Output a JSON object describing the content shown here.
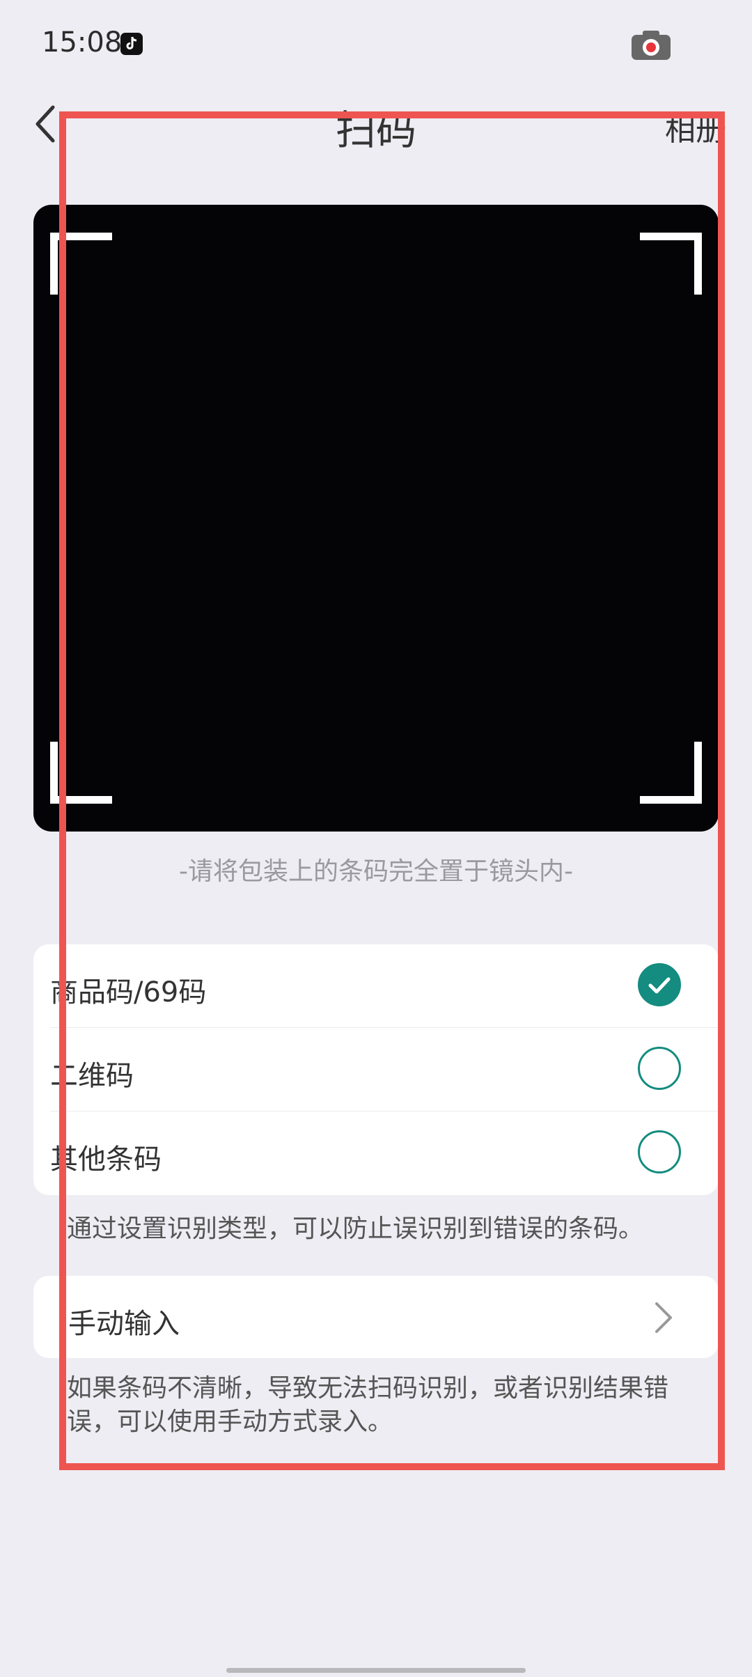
{
  "status_bar": {
    "time": "15:08",
    "app_icon": "tiktok-icon",
    "record_icon": "screen-record-icon"
  },
  "nav": {
    "back_icon": "chevron-left-icon",
    "title": "扫码",
    "album": "相册"
  },
  "scanner": {
    "hint": "-请将包装上的条码完全置于镜头内-"
  },
  "code_types": {
    "options": [
      {
        "label": "商品码/69码",
        "selected": true
      },
      {
        "label": "二维码",
        "selected": false
      },
      {
        "label": "其他条码",
        "selected": false
      }
    ],
    "help": "通过设置识别类型，可以防止误识别到错误的条码。"
  },
  "manual_entry": {
    "label": "手动输入",
    "help": "如果条码不清晰，导致无法扫码识别，或者识别结果错误，可以使用手动方式录入。"
  },
  "colors": {
    "accent": "#148c7f",
    "background": "#eeedf3",
    "annotation": "#ee5551"
  }
}
